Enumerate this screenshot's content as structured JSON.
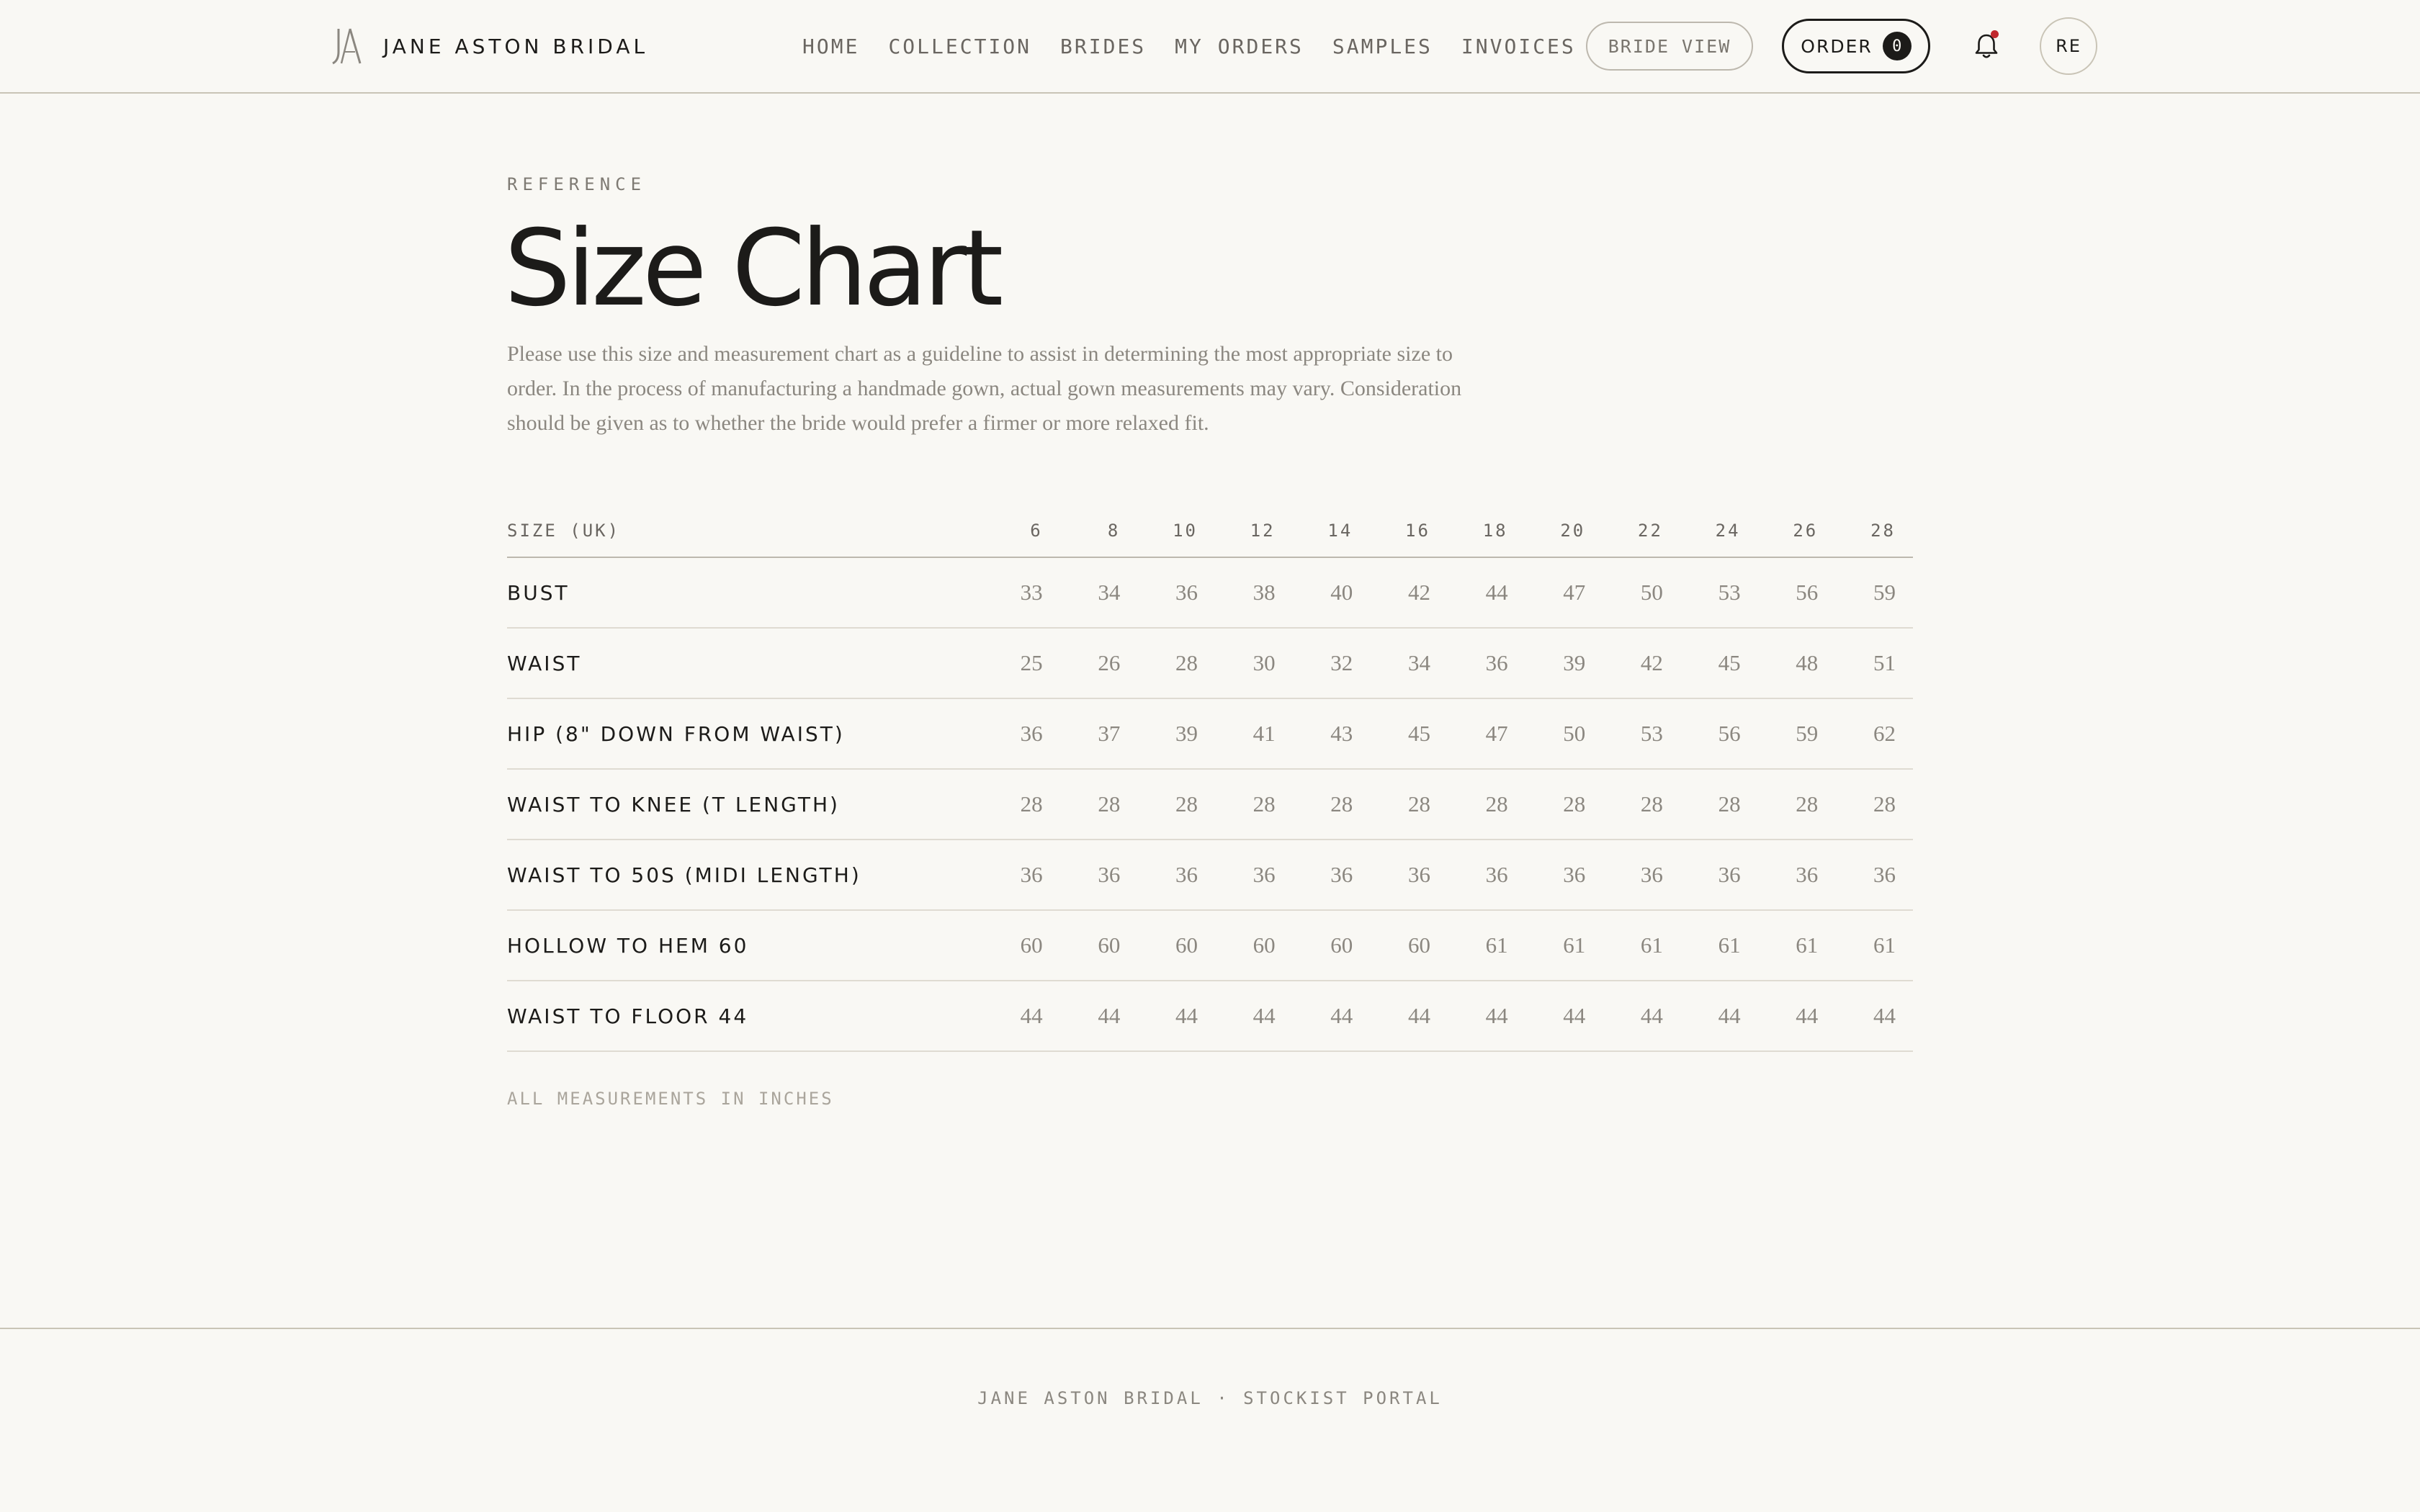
{
  "header": {
    "brand_name": "JANE ASTON BRIDAL",
    "nav": [
      "HOME",
      "COLLECTION",
      "BRIDES",
      "MY ORDERS",
      "SAMPLES",
      "INVOICES"
    ],
    "bride_view_label": "BRIDE VIEW",
    "order_label": "ORDER",
    "order_count": "0",
    "notification_icon": "bell-icon",
    "notification_dot_color": "#c0282e",
    "avatar_initials": "RE"
  },
  "main": {
    "eyebrow": "REFERENCE",
    "title": "Size Chart",
    "intro": "Please use this size and measurement chart as a guideline to assist in determining the most appropriate size to order. In the process of manufacturing a handmade gown, actual gown measurements may vary. Consideration should be given as to whether the bride would prefer a firmer or more relaxed fit.",
    "table": {
      "header_label": "SIZE (UK)",
      "sizes": [
        "6",
        "8",
        "10",
        "12",
        "14",
        "16",
        "18",
        "20",
        "22",
        "24",
        "26",
        "28"
      ],
      "rows": [
        {
          "label": "BUST",
          "values": [
            "33",
            "34",
            "36",
            "38",
            "40",
            "42",
            "44",
            "47",
            "50",
            "53",
            "56",
            "59"
          ]
        },
        {
          "label": "WAIST",
          "values": [
            "25",
            "26",
            "28",
            "30",
            "32",
            "34",
            "36",
            "39",
            "42",
            "45",
            "48",
            "51"
          ]
        },
        {
          "label": "HIP (8\" DOWN FROM WAIST)",
          "values": [
            "36",
            "37",
            "39",
            "41",
            "43",
            "45",
            "47",
            "50",
            "53",
            "56",
            "59",
            "62"
          ]
        },
        {
          "label": "WAIST TO KNEE (T LENGTH)",
          "values": [
            "28",
            "28",
            "28",
            "28",
            "28",
            "28",
            "28",
            "28",
            "28",
            "28",
            "28",
            "28"
          ]
        },
        {
          "label": "WAIST TO 50S (MIDI LENGTH)",
          "values": [
            "36",
            "36",
            "36",
            "36",
            "36",
            "36",
            "36",
            "36",
            "36",
            "36",
            "36",
            "36"
          ]
        },
        {
          "label": "HOLLOW TO HEM 60",
          "values": [
            "60",
            "60",
            "60",
            "60",
            "60",
            "60",
            "61",
            "61",
            "61",
            "61",
            "61",
            "61"
          ]
        },
        {
          "label": "WAIST TO FLOOR 44",
          "values": [
            "44",
            "44",
            "44",
            "44",
            "44",
            "44",
            "44",
            "44",
            "44",
            "44",
            "44",
            "44"
          ]
        }
      ]
    },
    "note": "ALL MEASUREMENTS IN INCHES"
  },
  "footer": {
    "text": "JANE ASTON BRIDAL · STOCKIST PORTAL"
  }
}
